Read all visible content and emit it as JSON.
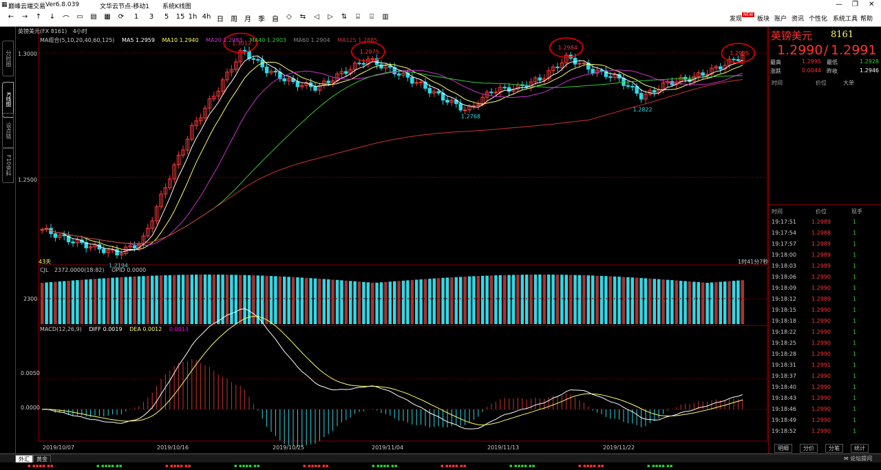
{
  "titlebar": {
    "app": "巅峰云端交易",
    "version": "Ver6.8.039",
    "server": "文华云节点-移动1",
    "view": "系统K线图"
  },
  "toolbar_glyphs": [
    "←",
    "→",
    "↑",
    "↓",
    "⌒",
    "▭",
    "▤",
    "▦",
    "⟳",
    "1",
    "3",
    "5",
    "15",
    "1h",
    "4h",
    "日",
    "周",
    "月",
    "季",
    "自",
    "◇",
    "⇆",
    "◁",
    "▷",
    "⇅",
    "⌸",
    "⌹",
    "▥"
  ],
  "right_menu": {
    "find": "发现",
    "find_badge": "NEW",
    "sector": "板块",
    "account": "账户",
    "news": "资讯",
    "personal": "个性化",
    "tools": "系统工具",
    "help": "帮助"
  },
  "side_tabs": [
    "分时图",
    "K线图",
    "设点链",
    "F10资料"
  ],
  "chart_header": {
    "symbol": "英镑美元(FX 8161)",
    "period": "4小时"
  },
  "ma_labels": [
    "MA组合(5,10,20,40,60,125)",
    "MA5 1.2959",
    "MA10 1.2940",
    "MA20 1.2983",
    "MA40 1.2903",
    "MA60 1.2904",
    "MA125 1.2885"
  ],
  "price_axis": [
    "1.3000",
    "1.2500"
  ],
  "annotations": {
    "p1": "1.3012",
    "p2": "1.2975",
    "p3": "1.2984",
    "p4": "1.2995",
    "low1": "1.2194",
    "low2": "1.2768",
    "low3": "1.2822",
    "bars_count": "43天",
    "countdown": "1时41分7秒"
  },
  "volume": {
    "label": "CJL",
    "value": "2372.0000(18:82)",
    "opid": "OPID 0.0000",
    "axis": "2300"
  },
  "macd": {
    "label": "MACD(12,26,9)",
    "diff": "DIFF 0.0019",
    "dea": "DEA 0.0012",
    "macd": "0.0013",
    "axis": [
      "0.0050",
      "0.0000"
    ]
  },
  "dates": [
    "2019/10/07",
    "2019/10/16",
    "2019/10/25",
    "2019/11/04",
    "2019/11/13",
    "2019/11/22"
  ],
  "quote": {
    "name": "英镑美元",
    "code": "8161",
    "bid": "1.2990",
    "ask": "1.2991",
    "high_label": "最高",
    "high": "1.2995",
    "low_label": "最低",
    "low": "1.2928",
    "change_label": "涨跌",
    "change": "0.0044",
    "prev_label": "昨收",
    "prev": "1.2946"
  },
  "table_headers": {
    "time": "时间",
    "price": "价位",
    "big": "大单"
  },
  "trade_headers": {
    "time": "时间",
    "price": "价位",
    "hand": "现手"
  },
  "trades": [
    {
      "t": "19:17:51",
      "p": "1.2989",
      "h": "1"
    },
    {
      "t": "19:17:54",
      "p": "1.2988",
      "h": "1"
    },
    {
      "t": "19:17:57",
      "p": "1.2989",
      "h": "1"
    },
    {
      "t": "19:18:00",
      "p": "1.2989",
      "h": "1"
    },
    {
      "t": "19:18:03",
      "p": "1.2989",
      "h": "1"
    },
    {
      "t": "19:18:06",
      "p": "1.2990",
      "h": "1"
    },
    {
      "t": "19:18:09",
      "p": "1.2990",
      "h": "1"
    },
    {
      "t": "19:18:12",
      "p": "1.2989",
      "h": "1"
    },
    {
      "t": "19:18:15",
      "p": "1.2990",
      "h": "1"
    },
    {
      "t": "19:18:18",
      "p": "1.2990",
      "h": "1"
    },
    {
      "t": "19:18:22",
      "p": "1.2990",
      "h": "1"
    },
    {
      "t": "19:18:25",
      "p": "1.2990",
      "h": "1"
    },
    {
      "t": "19:18:28",
      "p": "1.2990",
      "h": "1"
    },
    {
      "t": "19:18:31",
      "p": "1.2991",
      "h": "1"
    },
    {
      "t": "19:18:37",
      "p": "1.2990",
      "h": "1"
    },
    {
      "t": "19:18:40",
      "p": "1.2990",
      "h": "1"
    },
    {
      "t": "19:18:43",
      "p": "1.2990",
      "h": "1"
    },
    {
      "t": "19:18:46",
      "p": "1.2990",
      "h": "1"
    },
    {
      "t": "19:18:49",
      "p": "1.2990",
      "h": "1"
    },
    {
      "t": "19:18:52",
      "p": "1.2990",
      "h": "1"
    }
  ],
  "panel_tabs": [
    "明细",
    "分价",
    "分笔",
    "统计"
  ],
  "bottom_tabs": [
    "外汇",
    "黄金"
  ],
  "forum": "论坛提问",
  "colors": {
    "up": "#ff3b3b",
    "down": "#2fd9e6",
    "ma5": "#ffffff",
    "ma10": "#ffff66",
    "ma20": "#cc33cc",
    "ma40": "#33cc33",
    "ma125": "#cc3333",
    "bg": "#000000"
  },
  "chart_data": {
    "type": "candlestick",
    "dates": [
      "2019/10/07",
      "2019/10/16",
      "2019/10/25",
      "2019/11/04",
      "2019/11/13",
      "2019/11/22"
    ],
    "price_range": [
      1.215,
      1.305
    ],
    "close_samples": [
      1.229,
      1.225,
      1.222,
      1.2194,
      1.224,
      1.248,
      1.27,
      1.285,
      1.3012,
      1.293,
      1.288,
      1.286,
      1.292,
      1.2975,
      1.293,
      1.288,
      1.282,
      1.2768,
      1.285,
      1.286,
      1.29,
      1.2984,
      1.293,
      1.29,
      1.2822,
      1.288,
      1.29,
      1.294,
      1.299
    ],
    "macd_range": [
      -0.005,
      0.012
    ]
  }
}
